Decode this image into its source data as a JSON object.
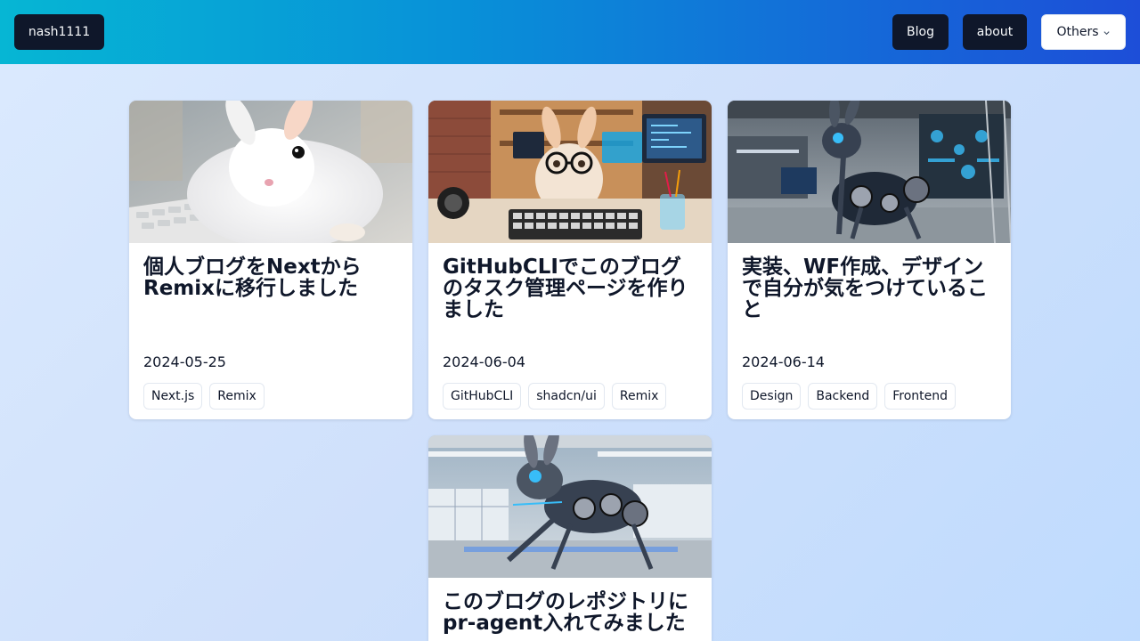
{
  "header": {
    "brand_label": "nash1111",
    "nav": {
      "blog": "Blog",
      "about": "about",
      "others": "Others"
    }
  },
  "posts": [
    {
      "title": "個人ブログをNextからRemixに移行しました",
      "date": "2024-05-25",
      "tags": [
        "Next.js",
        "Remix"
      ],
      "image": "white-bunny-at-keyboard"
    },
    {
      "title": "GitHubCLIでこのブログのタスク管理ページを作りました",
      "date": "2024-06-04",
      "tags": [
        "GitHubCLI",
        "shadcn/ui",
        "Remix"
      ],
      "image": "bunny-with-glasses-at-desk"
    },
    {
      "title": "実装、WF作成、デザインで自分が気をつけていること",
      "date": "2024-06-14",
      "tags": [
        "Design",
        "Backend",
        "Frontend"
      ],
      "image": "robot-rabbit-in-lab"
    },
    {
      "title": "このブログのレポジトリにpr-agent入れてみました",
      "image": "robot-rabbit-leaping"
    }
  ],
  "colors": {
    "header_start": "#06b6d4",
    "header_end": "#1d4ed8",
    "dark_button": "#0f172a",
    "background": "#dbeafe"
  }
}
